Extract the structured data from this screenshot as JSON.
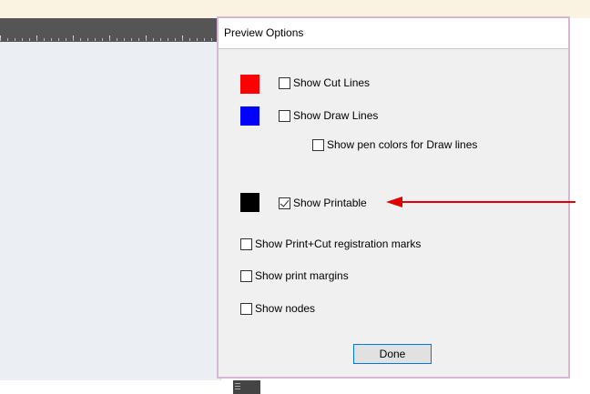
{
  "dialog": {
    "title": "Preview Options",
    "options": {
      "cut_lines": {
        "label": "Show Cut Lines",
        "checked": false,
        "color": "#ff0000"
      },
      "draw_lines": {
        "label": "Show Draw Lines",
        "checked": false,
        "color": "#0000ff"
      },
      "pen_colors": {
        "label": "Show pen colors for Draw lines",
        "checked": false
      },
      "printable": {
        "label": "Show Printable",
        "checked": true,
        "color": "#000000"
      },
      "registration_marks": {
        "label": "Show Print+Cut registration marks",
        "checked": false
      },
      "print_margins": {
        "label": "Show print margins",
        "checked": false
      },
      "nodes": {
        "label": "Show nodes",
        "checked": false
      }
    },
    "done_label": "Done"
  },
  "annotation": {
    "arrow_color": "#e00000",
    "arrow_icon": "arrow-left-icon"
  }
}
